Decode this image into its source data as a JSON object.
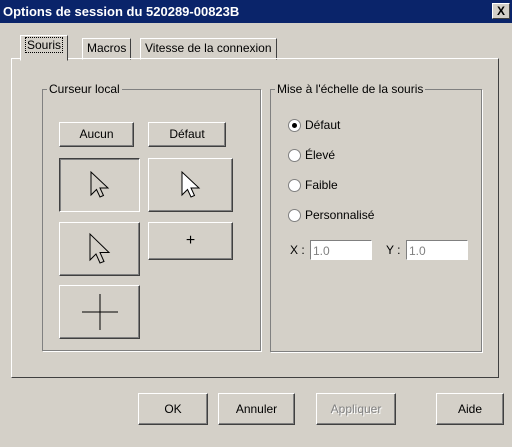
{
  "window": {
    "title": "Options de session du 520289-00823B",
    "close_label": "X"
  },
  "tabs": [
    {
      "label": "Souris",
      "active": true
    },
    {
      "label": "Macros",
      "active": false
    },
    {
      "label": "Vitesse de la connexion",
      "active": false
    }
  ],
  "cursor_group": {
    "legend": "Curseur local",
    "none_label": "Aucun",
    "default_label": "Défaut",
    "plus_label": "+"
  },
  "scaling_group": {
    "legend": "Mise à l'échelle de la souris",
    "options": [
      {
        "label": "Défaut",
        "selected": true
      },
      {
        "label": "Élevé",
        "selected": false
      },
      {
        "label": "Faible",
        "selected": false
      },
      {
        "label": "Personnalisé",
        "selected": false
      }
    ],
    "x_label": "X :",
    "x_value": "1.0",
    "y_label": "Y :",
    "y_value": "1.0"
  },
  "footer": {
    "ok_label": "OK",
    "cancel_label": "Annuler",
    "apply_label": "Appliquer",
    "help_label": "Aide"
  }
}
